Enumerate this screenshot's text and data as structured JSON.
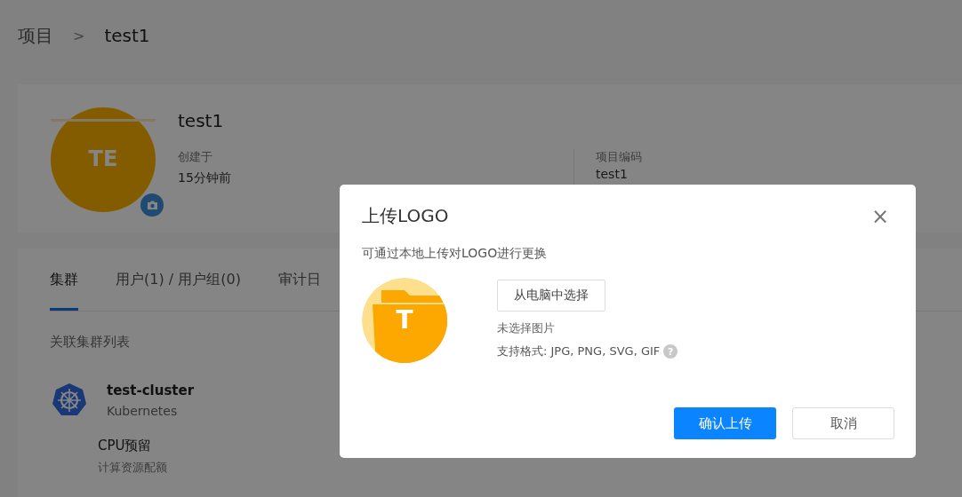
{
  "breadcrumb": {
    "parent": "项目",
    "separator": ">",
    "current": "test1"
  },
  "project": {
    "avatar_text": "TE",
    "name": "test1",
    "created_label": "创建于",
    "created_value": "15分钟前",
    "code_label": "项目编码",
    "code_value": "test1"
  },
  "tabs": [
    {
      "label": "集群",
      "selected": true
    },
    {
      "label": "用户(1) / 用户组(0)",
      "selected": false
    },
    {
      "label": "审计日",
      "selected": false
    }
  ],
  "section_title": "关联集群列表",
  "cluster": {
    "name": "test-cluster",
    "type": "Kubernetes"
  },
  "quota": {
    "title": "CPU预留",
    "subtitle": "计算资源配额"
  },
  "dialog": {
    "title": "上传LOGO",
    "close": "×",
    "description": "可通过本地上传对LOGO进行更换",
    "preview_letter": "T",
    "choose_button": "从电脑中选择",
    "file_status": "未选择图片",
    "formats": "支持格式: JPG, PNG, SVG, GIF",
    "help": "?",
    "buttons": [
      {
        "label": "确认上传",
        "kind": "primary"
      },
      {
        "label": "取消",
        "kind": "secondary"
      }
    ]
  }
}
